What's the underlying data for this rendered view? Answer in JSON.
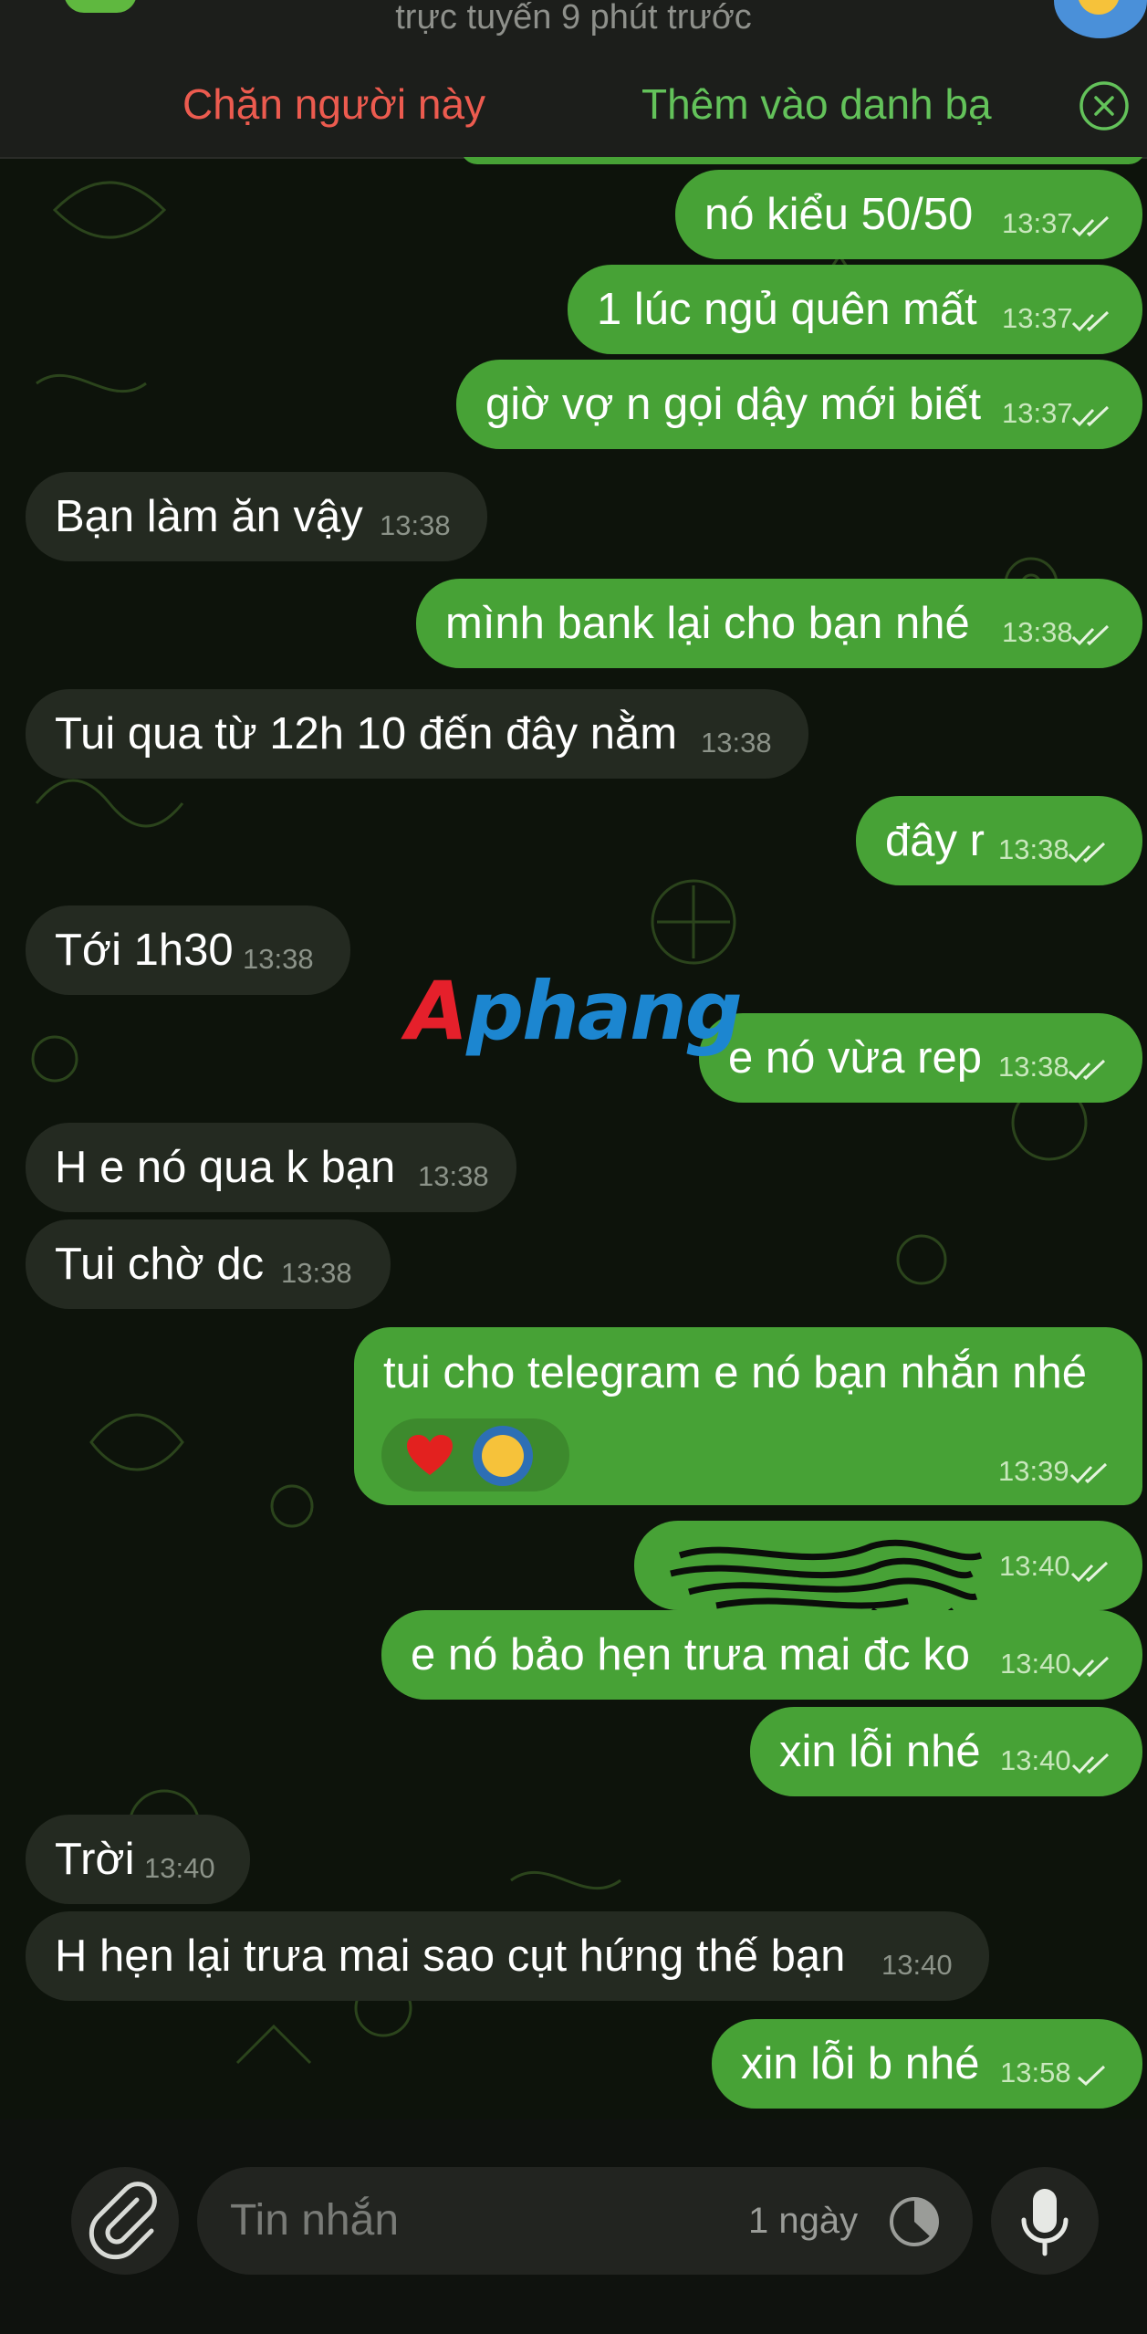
{
  "header": {
    "status": "trực tuyến 9 phút trước",
    "block_label": "Chặn người này",
    "add_contact_label": "Thêm vào danh bạ"
  },
  "messages": [
    {
      "dir": "out",
      "text": "nó kiểu 50/50",
      "time": "13:37",
      "status": "read"
    },
    {
      "dir": "out",
      "text": "1 lúc ngủ quên mất",
      "time": "13:37",
      "status": "read"
    },
    {
      "dir": "out",
      "text": "giờ vợ n gọi dậy mới biết",
      "time": "13:37",
      "status": "read"
    },
    {
      "dir": "in",
      "text": "Bạn làm ăn vậy",
      "time": "13:38"
    },
    {
      "dir": "out",
      "text": "mình bank lại cho bạn nhé",
      "time": "13:38",
      "status": "read"
    },
    {
      "dir": "in",
      "text": "Tui qua từ 12h 10 đến đây nằm",
      "time": "13:38"
    },
    {
      "dir": "out",
      "text": "đây r",
      "time": "13:38",
      "status": "read"
    },
    {
      "dir": "in",
      "text": "Tới 1h30",
      "time": "13:38"
    },
    {
      "dir": "out",
      "text": "e nó vừa rep",
      "time": "13:38",
      "status": "read"
    },
    {
      "dir": "in",
      "text": "H e nó qua k bạn",
      "time": "13:38"
    },
    {
      "dir": "in",
      "text": "Tui chờ dc",
      "time": "13:38"
    }
  ],
  "reaction_message": {
    "text": "tui cho telegram e nó bạn nhắn nhé",
    "time": "13:39",
    "reactions": [
      "heart",
      "laughing-face"
    ]
  },
  "redacted_message": {
    "time": "13:40",
    "status": "read"
  },
  "messages2": [
    {
      "dir": "out",
      "text": "e nó bảo hẹn trưa mai đc ko",
      "time": "13:40",
      "status": "read"
    },
    {
      "dir": "out",
      "text": "xin lỗi nhé",
      "time": "13:40",
      "status": "read"
    },
    {
      "dir": "in",
      "text": "Trời",
      "time": "13:40"
    },
    {
      "dir": "in",
      "text": "H hẹn lại trưa mai sao cụt hứng thế bạn",
      "time": "13:40"
    },
    {
      "dir": "out",
      "text": "xin lỗi b nhé",
      "time": "13:58",
      "status": "delivered"
    }
  ],
  "watermark": {
    "first": "A",
    "rest": "phang"
  },
  "input": {
    "placeholder": "Tin nhắn",
    "timer_label": "1 ngày"
  },
  "colors": {
    "outgoing_bubble": "#47a236",
    "incoming_bubble": "#242a21",
    "block_text": "#ec5b4f",
    "add_contact_text": "#63c25a"
  }
}
